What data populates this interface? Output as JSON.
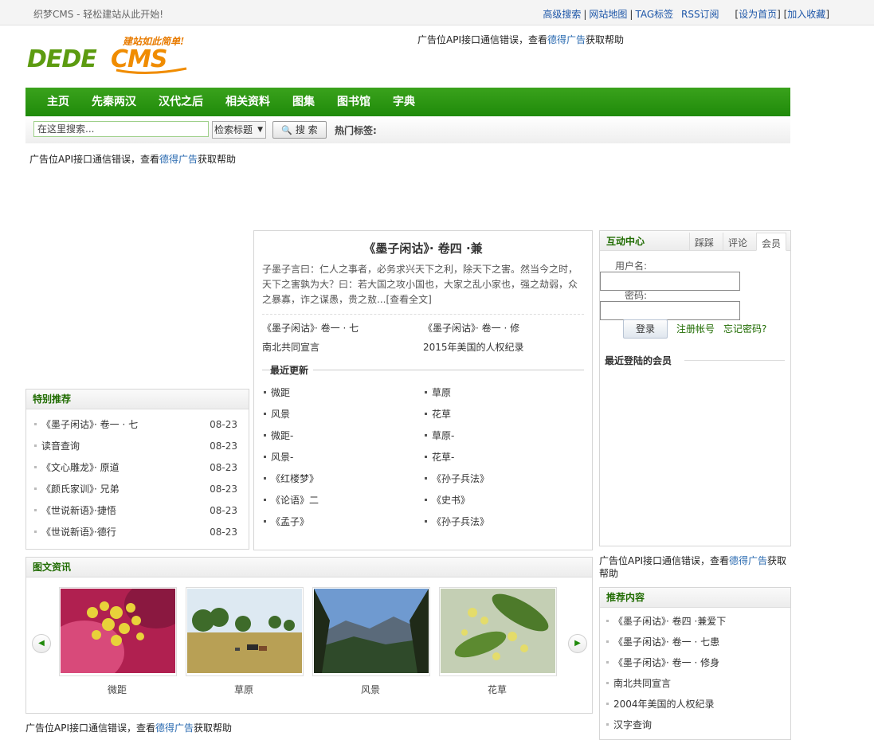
{
  "topbar": {
    "welcome": "织梦CMS - 轻松建站从此开始!",
    "links": [
      "高级搜索",
      "网站地图",
      "TAG标签",
      "RSS订阅"
    ],
    "set_home": "设为首页",
    "add_fav": "加入收藏"
  },
  "logo": {
    "text": "DEDECMS",
    "slogan": "建站如此简单!"
  },
  "ad": {
    "prefix": "广告位API接口通信错误，查看",
    "link": "德得广告",
    "suffix": "获取帮助"
  },
  "nav": [
    "主页",
    "先秦两汉",
    "汉代之后",
    "相关资料",
    "图集",
    "图书馆",
    "字典"
  ],
  "search": {
    "placeholder": "在这里搜索...",
    "select_value": "检索标题",
    "button": "搜 索",
    "hot_tags": "热门标签:"
  },
  "special": {
    "title": "特别推荐",
    "items": [
      {
        "title": "《墨子闲诂》· 卷一 · 七",
        "date": "08-23"
      },
      {
        "title": "读音查询",
        "date": "08-23"
      },
      {
        "title": "《文心雕龙》· 原道",
        "date": "08-23"
      },
      {
        "title": "《颜氏家训》· 兄弟",
        "date": "08-23"
      },
      {
        "title": "《世说新语》·捷悟",
        "date": "08-23"
      },
      {
        "title": "《世说新语》·德行",
        "date": "08-23"
      }
    ]
  },
  "article": {
    "title": "《墨子闲诂》· 卷四 ·兼",
    "summary": "子墨子言曰：仁人之事者，必务求兴天下之利，除天下之害。然当今之时，天下之害孰为大？曰：若大国之攻小国也，大家之乱小家也，强之劫弱，众之暴寡，诈之谋愚，贵之敖...",
    "more": "[查看全文]",
    "pairs": [
      [
        "《墨子闲诂》· 卷一 · 七",
        "《墨子闲诂》· 卷一 · 修"
      ],
      [
        "南北共同宣言",
        "2015年美国的人权纪录"
      ]
    ],
    "recent_title": "最近更新",
    "recent": [
      "微距",
      "草原",
      "风景",
      "花草",
      "微距-",
      "草原-",
      "风景-",
      "花草-",
      "《红楼梦》",
      "《孙子兵法》",
      "《论语》二",
      "《史书》",
      "《孟子》",
      "《孙子兵法》"
    ]
  },
  "interactive": {
    "title": "互动中心",
    "tabs": [
      "踩踩",
      "评论",
      "会员"
    ],
    "username_label": "用户名:",
    "password_label": "密码:",
    "login": "登录",
    "register": "注册帐号",
    "forgot": "忘记密码?",
    "recent_members": "最近登陆的会员"
  },
  "pictures": {
    "title": "图文资讯",
    "items": [
      "微距",
      "草原",
      "风景",
      "花草"
    ]
  },
  "recommend": {
    "title": "推荐内容",
    "items": [
      "《墨子闲诂》· 卷四 ·兼爱下",
      "《墨子闲诂》· 卷一 · 七患",
      "《墨子闲诂》· 卷一 · 修身",
      "南北共同宣言",
      "2004年美国的人权纪录",
      "汉字查询"
    ]
  },
  "colors": {
    "nav_green": "#1f8a0a",
    "link_blue": "#1d56a8",
    "head_green": "#1f6b00"
  }
}
